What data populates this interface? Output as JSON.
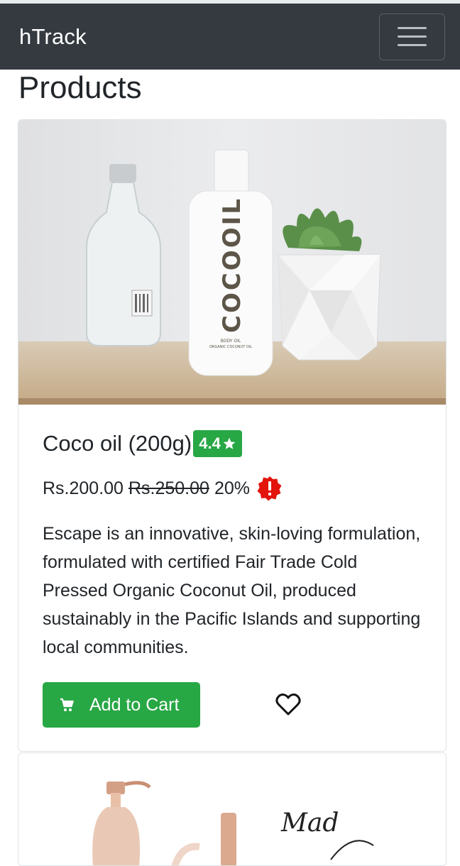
{
  "navbar": {
    "brand": "hTrack",
    "toggle_icon": "hamburger-menu-icon"
  },
  "page": {
    "title": "Products"
  },
  "products": [
    {
      "name": "Coco oil (200g)",
      "rating": "4.4",
      "rating_icon": "star-icon",
      "price": "Rs.200.00",
      "original_price": "Rs.250.00",
      "discount": "20%",
      "discount_icon": "alert-badge-icon",
      "description": "Escape is an innovative, skin-loving formulation, formulated with certified Fair Trade Cold Pressed Organic Coconut Oil, produced sustainably in the Pacific Islands and supporting local communities.",
      "image": {
        "bottle_brand": "COCOOIL",
        "bottle_sub": "BODY OIL",
        "bottle_sub2": "ORGANIC COCONUT OIL"
      },
      "add_to_cart_label": "Add to Cart",
      "cart_icon": "shopping-cart-icon",
      "wishlist_icon": "heart-icon"
    },
    {
      "image": {
        "script_text": "Mad"
      }
    }
  ],
  "colors": {
    "navbar": "#343a40",
    "success": "#28a745",
    "alert": "#e3140c"
  }
}
